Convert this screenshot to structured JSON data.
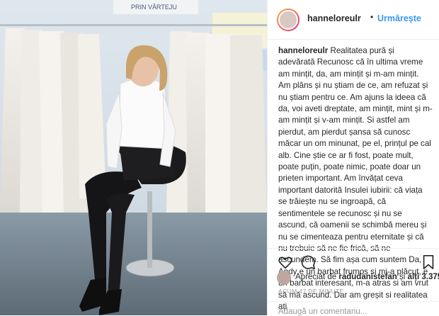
{
  "post": {
    "username": "hanneloreulr",
    "follow_label": "Urmărește",
    "separator": "•",
    "caption_user": "hanneloreulr",
    "caption_text": "Realitatea pură și adevărată Recunosc că în ultima vreme am mințit, da, am mințit și m-am mințit. Am plâns și nu știam de ce, am refuzat și nu știam pentru ce. Am ajuns la ideea că da, voi aveti dreptate, am mințit, mint și m-am mințit și v-am mințit. Si astfel am pierdut, am pierdut șansa să cunosc măcar un om minunat, pe el, prințul pe cal alb. Cine știe ce ar fi fost, poate mult, poate puțin, poate nimic, poate doar un prieten important. Am învățat ceva important datorită Insulei iubirii: că viața se trăiește nu se ingroapă, că sentimentele se recunosc și nu se ascund, că oamenii se schimbă mereu și nu se cimenteaza pentru eternitate și că nu trebuie să ne fie frică, să ne ascundem. Să fim așa cum suntem Da, Andy e un barbat frumos si mi-a plăcut, e un barbat interesant, m-a atras si am vrut să mă ascund. Dar am greșit si realitatea ați",
    "likes_prefix": "Apreciat de",
    "likes_user": "radudanistefan",
    "likes_and": "și",
    "likes_others": "alți 3.375",
    "timestamp": "ACUM 47 DE MINUTE",
    "comment_placeholder": "Adaugă un comentariu..."
  },
  "photo": {
    "banner_text": "PRIN VÂRTEJU"
  },
  "icons": {
    "like": "heart-icon",
    "comment": "comment-icon",
    "bookmark": "bookmark-icon"
  }
}
